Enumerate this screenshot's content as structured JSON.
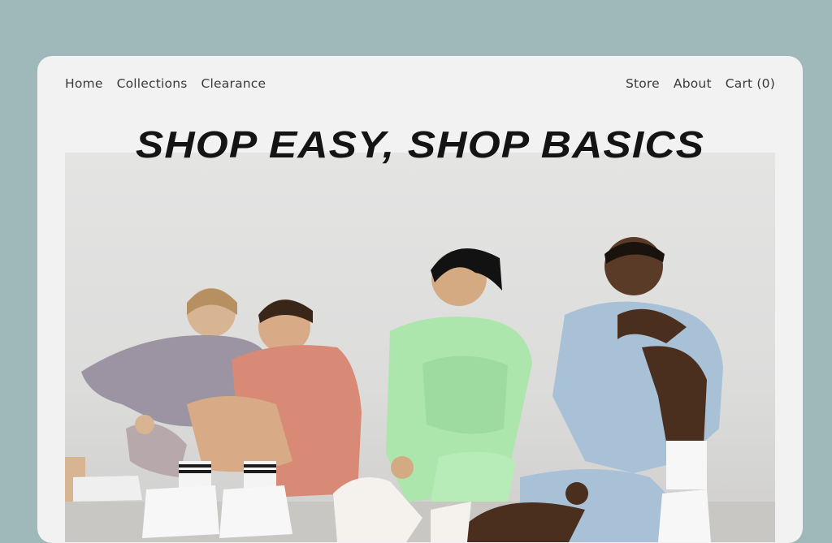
{
  "nav": {
    "left": [
      {
        "label": "Home"
      },
      {
        "label": "Collections"
      },
      {
        "label": "Clearance"
      }
    ],
    "right": [
      {
        "label": "Store"
      },
      {
        "label": "About"
      },
      {
        "label": "Cart (0)"
      }
    ]
  },
  "hero": {
    "title": "SHOP EASY, SHOP BASICS",
    "image_description_icon": "photo-icon"
  },
  "colors": {
    "page_background": "#9fb8b9",
    "card_background": "#f2f2f2",
    "title_color": "#141414",
    "outfit_lavender": "#9d94a3",
    "outfit_coral": "#d98a77",
    "outfit_mint": "#ace6ad",
    "outfit_sky": "#a9c1d6"
  }
}
